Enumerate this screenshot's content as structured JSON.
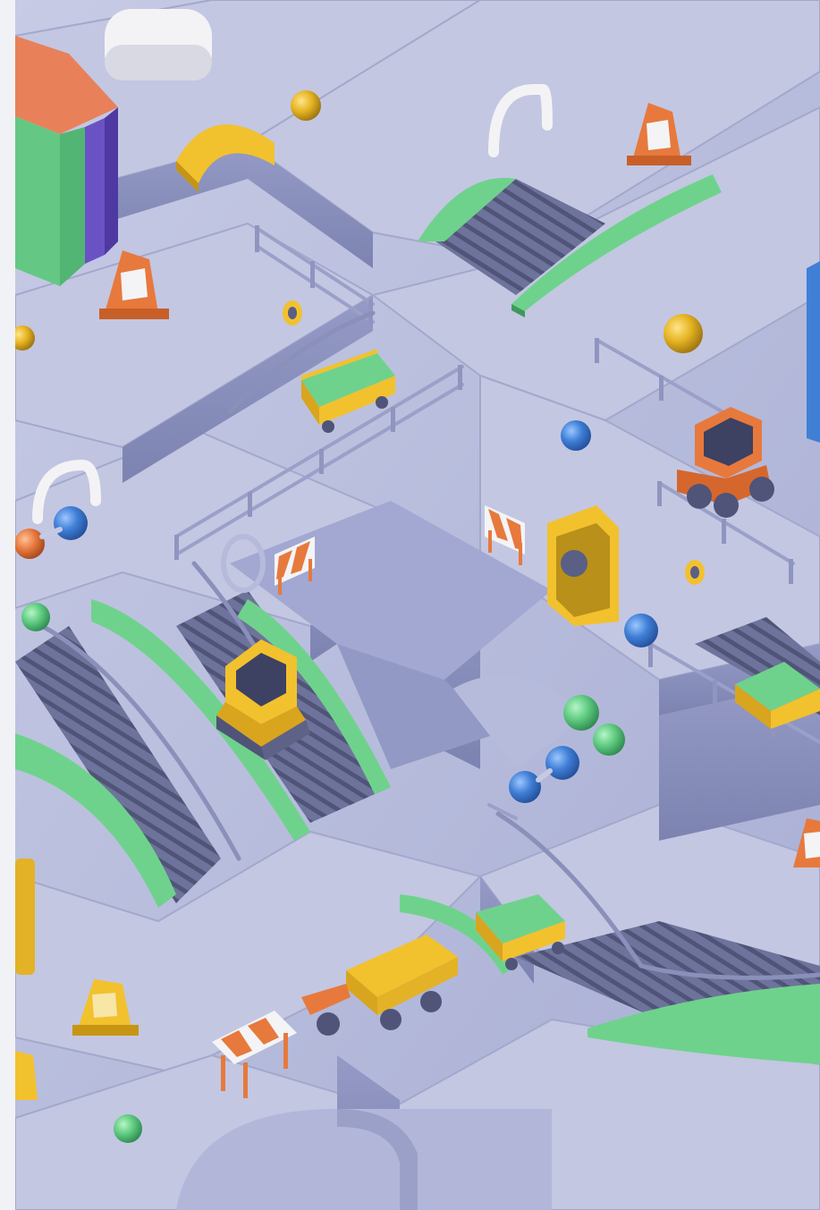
{
  "image": {
    "kind": "isometric-3d-render",
    "colors": {
      "floor_light": "#c5c9e3",
      "floor_mid": "#aeb3d6",
      "floor_shadow": "#8c92bd",
      "wall_dark": "#7b80ad",
      "green": "#6fd28c",
      "yellow": "#f2c12e",
      "orange": "#e7793d",
      "blue": "#3f7fd6",
      "purple": "#5a3ea8",
      "white": "#f4f4f6",
      "track": "#5d6286"
    },
    "objects": [
      {
        "name": "bulldozer-yellow",
        "icon": "bulldozer-icon"
      },
      {
        "name": "tractor-orange",
        "icon": "tractor-icon"
      },
      {
        "name": "mine-cart",
        "icon": "cart-icon"
      },
      {
        "name": "wheelbarrow",
        "icon": "wheelbarrow-icon"
      },
      {
        "name": "traffic-cone",
        "icon": "cone-icon"
      },
      {
        "name": "barricade",
        "icon": "barricade-icon"
      },
      {
        "name": "ball",
        "icon": "ball-icon"
      },
      {
        "name": "conveyor-ramp",
        "icon": "ramp-icon"
      }
    ]
  }
}
